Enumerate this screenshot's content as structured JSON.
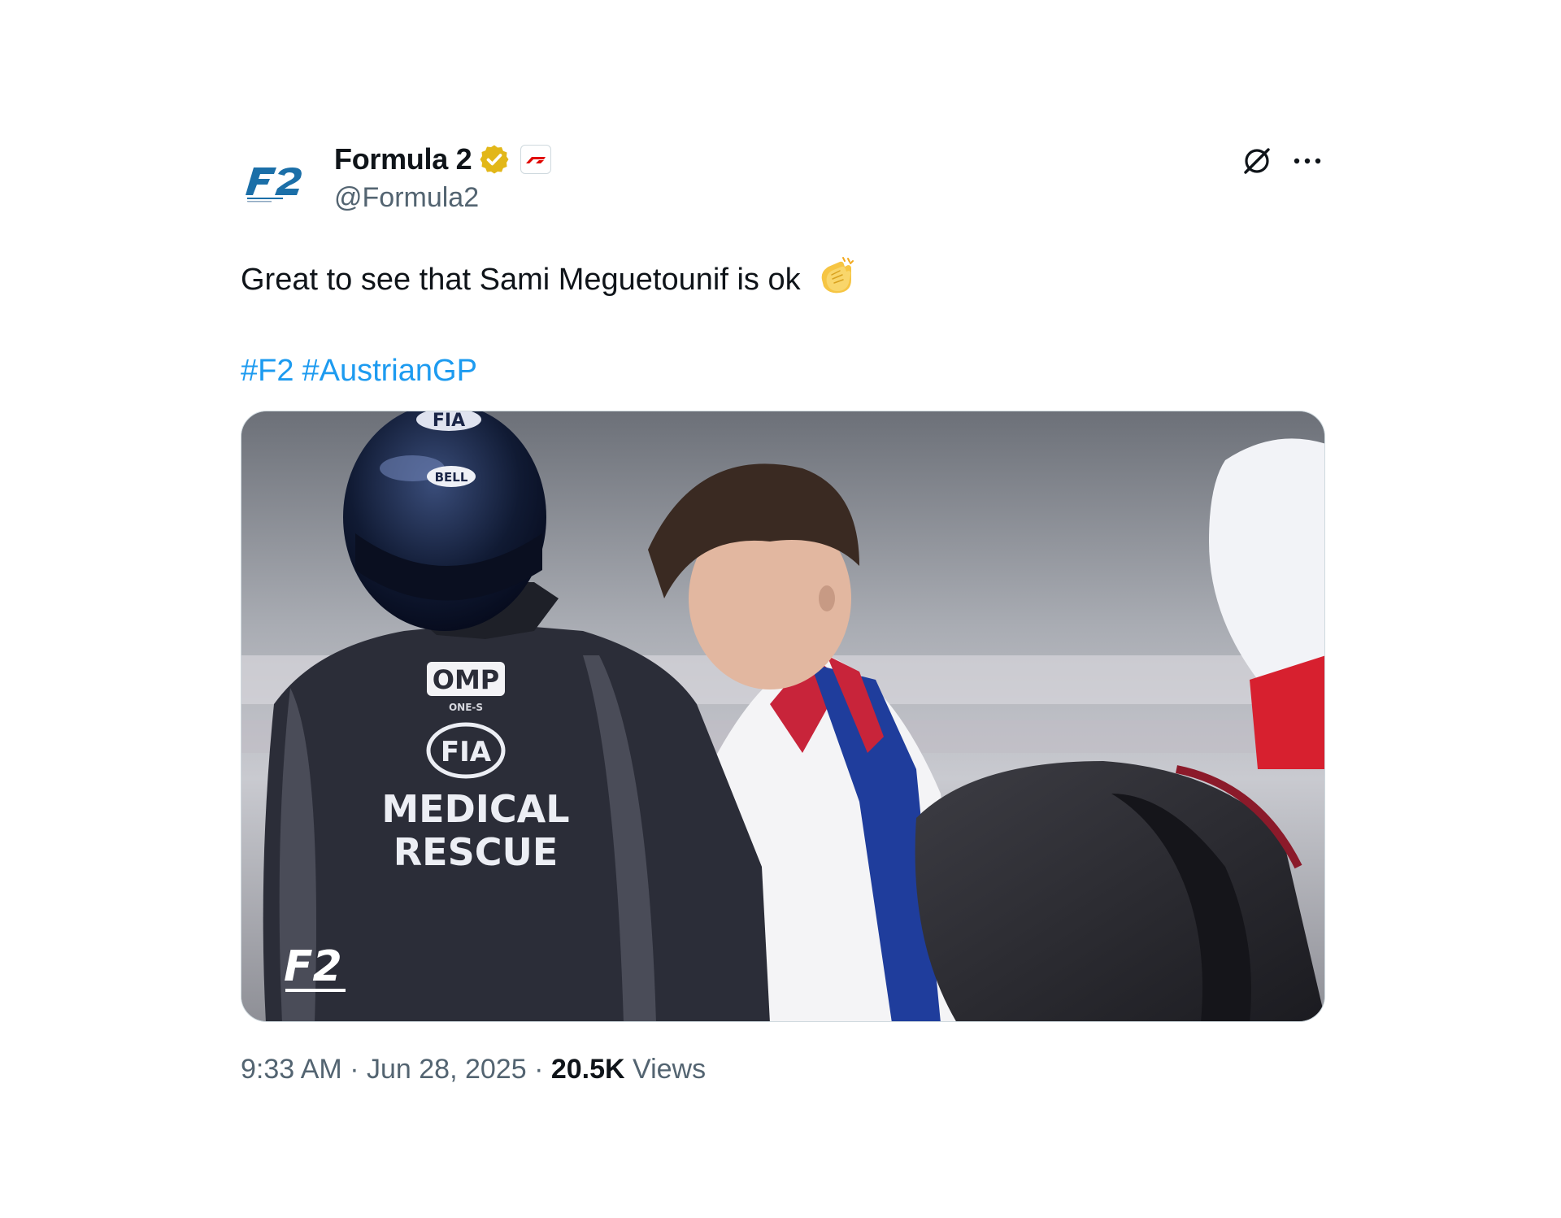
{
  "tweet": {
    "display_name": "Formula 2",
    "handle": "@Formula2",
    "text": "Great to see that Sami Meguetounif is ok",
    "hashtags": [
      "#F2",
      "#AustrianGP"
    ],
    "time": "9:33 AM",
    "separator": "·",
    "date": "Jun 28, 2025",
    "views_count": "20.5K",
    "views_label": "Views"
  },
  "icons": {
    "verified": "verified-badge-icon",
    "affiliate": "f1-affiliate-icon",
    "grok": "grok-icon",
    "more": "more-options-icon",
    "emoji": "clapping-hands-emoji"
  },
  "media": {
    "jacket_brand": "OMP",
    "jacket_sub": "ONE-S",
    "jacket_org": "FIA",
    "jacket_line1": "MEDICAL",
    "jacket_line2": "RESCUE",
    "helmet_brand": "BELL",
    "helmet_org": "FIA",
    "watermark": "F2"
  },
  "colors": {
    "hashtag": "#1d9bf0",
    "secondary_text": "#536471",
    "verified_gold": "#e2b719",
    "brand_blue": "#1b6fa8"
  }
}
